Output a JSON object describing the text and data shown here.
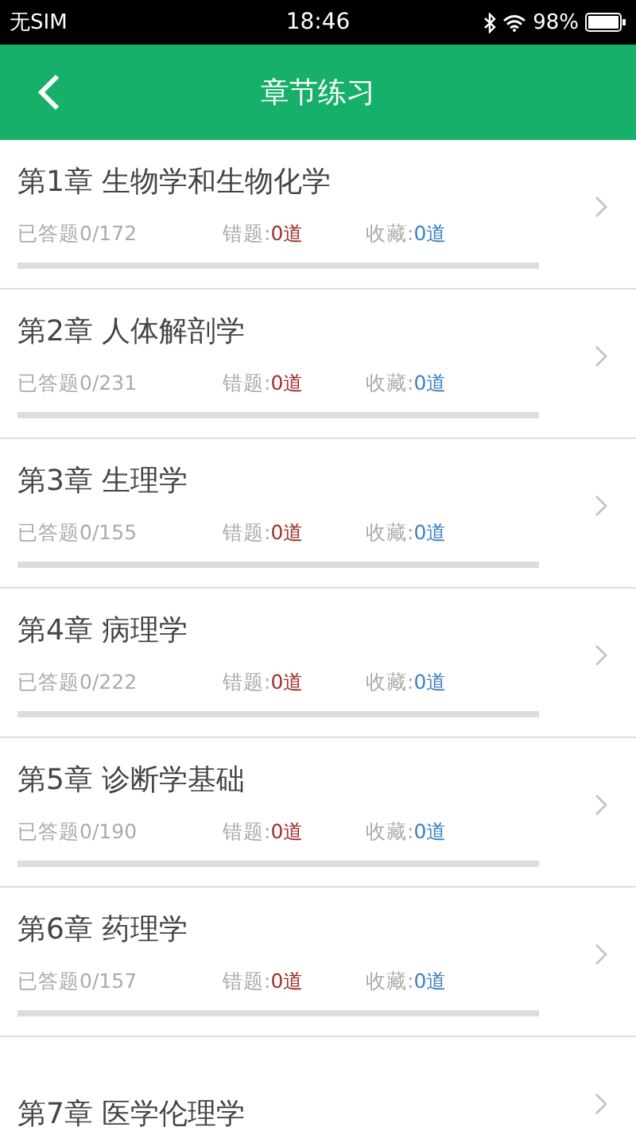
{
  "status_bar": {
    "carrier": "无SIM",
    "time": "18:46",
    "battery": "98%"
  },
  "header": {
    "title": "章节练习"
  },
  "chapters": [
    {
      "title": "第1章 生物学和生物化学",
      "answered": "已答题0/172",
      "wrong_label": "错题:",
      "wrong": "0道",
      "fav_label": "收藏:",
      "fav": "0道",
      "level": 0
    },
    {
      "title": "第2章 人体解剖学",
      "answered": "已答题0/231",
      "wrong_label": "错题:",
      "wrong": "0道",
      "fav_label": "收藏:",
      "fav": "0道",
      "level": 0
    },
    {
      "title": "第3章 生理学",
      "answered": "已答题0/155",
      "wrong_label": "错题:",
      "wrong": "0道",
      "fav_label": "收藏:",
      "fav": "0道",
      "level": 0
    },
    {
      "title": "第4章 病理学",
      "answered": "已答题0/222",
      "wrong_label": "错题:",
      "wrong": "0道",
      "fav_label": "收藏:",
      "fav": "0道",
      "level": 0
    },
    {
      "title": "第5章 诊断学基础",
      "answered": "已答题0/190",
      "wrong_label": "错题:",
      "wrong": "0道",
      "fav_label": "收藏:",
      "fav": "0道",
      "level": 0
    },
    {
      "title": "第6章 药理学",
      "answered": "已答题0/157",
      "wrong_label": "错题:",
      "wrong": "0道",
      "fav_label": "收藏:",
      "fav": "0道",
      "level": 0
    },
    {
      "title": "第7章 医学伦理学"
    }
  ]
}
